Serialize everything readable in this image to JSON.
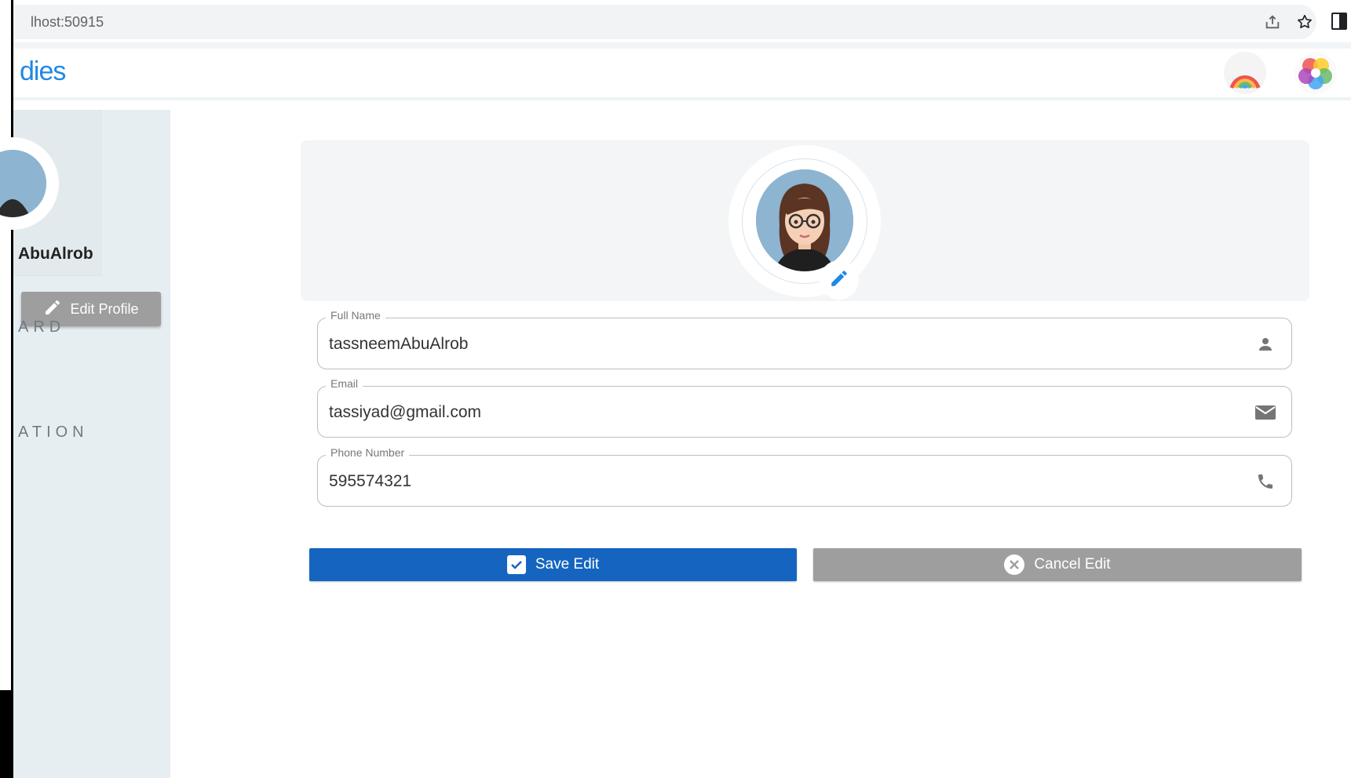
{
  "browser": {
    "url": "lhost:50915"
  },
  "header": {
    "app_title": "dies"
  },
  "sidebar": {
    "username": "AbuAlrob",
    "edit_profile_label": "Edit Profile",
    "nav_headings": [
      "ARD",
      "ATION"
    ]
  },
  "form": {
    "full_name": {
      "label": "Full Name",
      "value": "tassneemAbuAlrob"
    },
    "email": {
      "label": "Email",
      "value": "tassiyad@gmail.com"
    },
    "phone": {
      "label": "Phone Number",
      "value": "595574321"
    }
  },
  "actions": {
    "save_label": "Save Edit",
    "cancel_label": "Cancel Edit"
  },
  "colors": {
    "primary": "#1565c0",
    "title_blue": "#1e88e5",
    "neutral_button": "#9e9e9e",
    "sidebar_bg": "#e7eef1"
  },
  "icons": [
    "share-icon",
    "star-icon",
    "side-panel-icon",
    "pencil-icon",
    "person-icon",
    "mail-icon",
    "phone-icon",
    "checkbox-icon",
    "cancel-circle-icon"
  ]
}
